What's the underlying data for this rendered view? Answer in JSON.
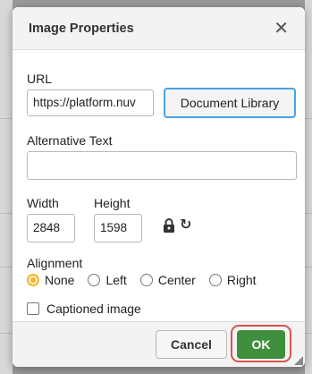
{
  "dialog": {
    "title": "Image Properties",
    "close_icon": "close-icon",
    "url_label": "URL",
    "url_value": "https://platform.nuv",
    "document_library_label": "Document Library",
    "alt_text_label": "Alternative Text",
    "alt_text_value": "",
    "width_label": "Width",
    "width_value": "2848",
    "height_label": "Height",
    "height_value": "1598",
    "lock_icon": "lock-icon",
    "reset_icon": "refresh-icon",
    "alignment_label": "Alignment",
    "alignment_options": [
      "None",
      "Left",
      "Center",
      "Right"
    ],
    "alignment_selected": "None",
    "captioned_label": "Captioned image",
    "captioned_checked": false,
    "cancel_label": "Cancel",
    "ok_label": "OK"
  },
  "colors": {
    "ok_button": "#3f8f3c",
    "highlight_ring": "#d9534f",
    "focus_border": "#4aa3e2",
    "radio_selected": "#f2b52a"
  }
}
